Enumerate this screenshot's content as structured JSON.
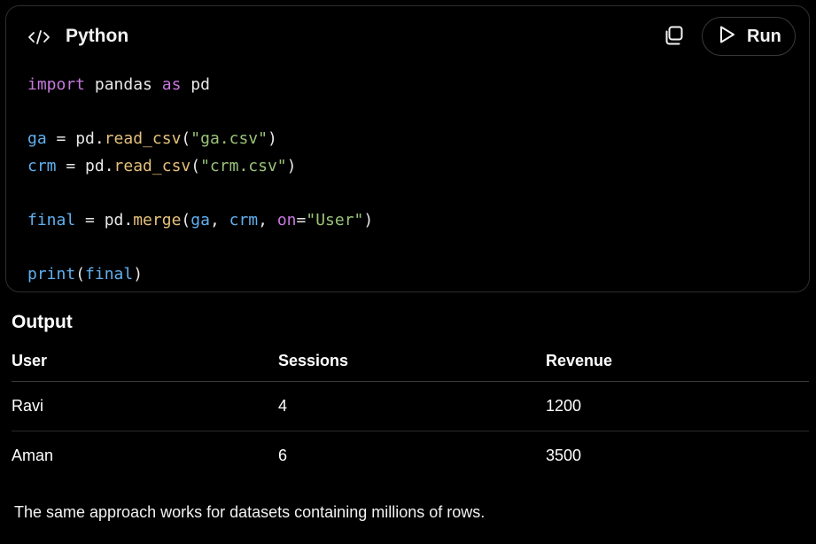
{
  "code_panel": {
    "language": "Python",
    "language_icon": "code-brackets-icon",
    "copy_icon": "copy-icon",
    "run_icon": "play-icon",
    "run_label": "Run",
    "lines": [
      [
        {
          "t": "kw",
          "v": "import"
        },
        {
          "t": "pl",
          "v": " pandas "
        },
        {
          "t": "kw",
          "v": "as"
        },
        {
          "t": "pl",
          "v": " pd"
        }
      ],
      [],
      [
        {
          "t": "var",
          "v": "ga"
        },
        {
          "t": "pl",
          "v": " = pd."
        },
        {
          "t": "fn",
          "v": "read_csv"
        },
        {
          "t": "pl",
          "v": "("
        },
        {
          "t": "str",
          "v": "\"ga.csv\""
        },
        {
          "t": "pl",
          "v": ")"
        }
      ],
      [
        {
          "t": "var",
          "v": "crm"
        },
        {
          "t": "pl",
          "v": " = pd."
        },
        {
          "t": "fn",
          "v": "read_csv"
        },
        {
          "t": "pl",
          "v": "("
        },
        {
          "t": "str",
          "v": "\"crm.csv\""
        },
        {
          "t": "pl",
          "v": ")"
        }
      ],
      [],
      [
        {
          "t": "var",
          "v": "final"
        },
        {
          "t": "pl",
          "v": " = pd."
        },
        {
          "t": "fn",
          "v": "merge"
        },
        {
          "t": "pl",
          "v": "("
        },
        {
          "t": "var",
          "v": "ga"
        },
        {
          "t": "pl",
          "v": ", "
        },
        {
          "t": "var",
          "v": "crm"
        },
        {
          "t": "pl",
          "v": ", "
        },
        {
          "t": "kw",
          "v": "on"
        },
        {
          "t": "pl",
          "v": "="
        },
        {
          "t": "str",
          "v": "\"User\""
        },
        {
          "t": "pl",
          "v": ")"
        }
      ],
      [],
      [
        {
          "t": "var",
          "v": "print"
        },
        {
          "t": "pl",
          "v": "("
        },
        {
          "t": "var",
          "v": "final"
        },
        {
          "t": "pl",
          "v": ")"
        }
      ]
    ]
  },
  "output": {
    "title": "Output",
    "columns": [
      "User",
      "Sessions",
      "Revenue"
    ],
    "rows": [
      [
        "Ravi",
        "4",
        "1200"
      ],
      [
        "Aman",
        "6",
        "3500"
      ]
    ]
  },
  "footer": {
    "note": "The same approach works for datasets containing millions of rows."
  },
  "colors": {
    "background": "#000000",
    "keyword": "#c678dd",
    "variable": "#61afef",
    "function": "#e5c07b",
    "string": "#98c379"
  }
}
